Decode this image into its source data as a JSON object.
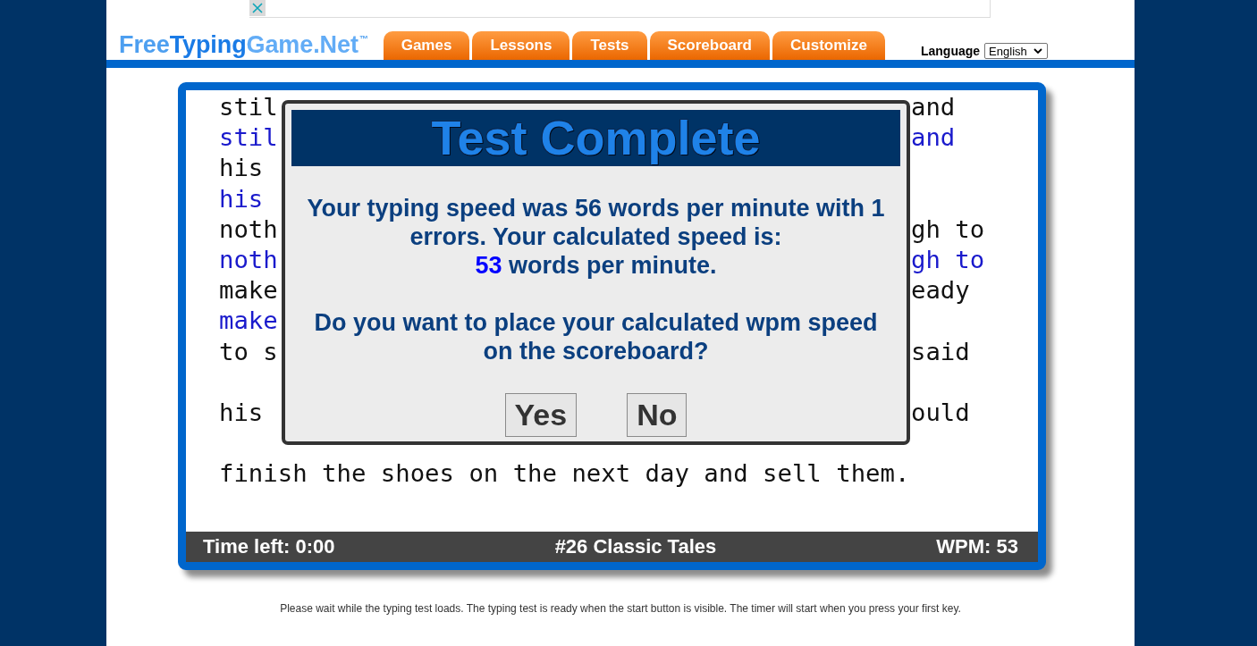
{
  "header": {
    "logo": {
      "parts": [
        "Free",
        "Typing",
        "Game.Net"
      ],
      "trademark": "™"
    },
    "nav_tabs": [
      {
        "label": "Games",
        "selected": false
      },
      {
        "label": "Lessons",
        "selected": false
      },
      {
        "label": "Tests",
        "selected": false
      },
      {
        "label": "Scoreboard",
        "selected": false
      },
      {
        "label": "Customize",
        "selected": false
      }
    ],
    "language": {
      "label": "Language",
      "value": "English"
    }
  },
  "test": {
    "lines": [
      {
        "kind": "source",
        "left": "stil",
        "right": "and"
      },
      {
        "kind": "typed",
        "left": "stil",
        "right": "and"
      },
      {
        "kind": "source",
        "left": "his"
      },
      {
        "kind": "typed",
        "left": "his"
      },
      {
        "kind": "source",
        "left": "noth",
        "right": "gh to"
      },
      {
        "kind": "typed",
        "left": "noth",
        "right": "gh to"
      },
      {
        "kind": "source",
        "left": "make",
        "right": "eady"
      },
      {
        "kind": "typed",
        "left": "make"
      },
      {
        "kind": "source",
        "left": "to s",
        "right": "said"
      },
      {
        "kind": "blank"
      },
      {
        "kind": "source",
        "left": "his",
        "right": "ould"
      },
      {
        "kind": "blank"
      },
      {
        "kind": "source",
        "left": "finish the shoes on the next day and sell them."
      }
    ],
    "status_bar": {
      "time_left": "Time left: 0:00",
      "test_name": "#26 Classic Tales",
      "wpm": "WPM: 53"
    }
  },
  "dialog": {
    "title": "Test Complete",
    "result": {
      "text": "Your typing speed was 56 words per minute with 1 errors. Your calculated speed is:",
      "calculated_wpm": "53",
      "unit": "words per minute."
    },
    "question": "Do you want to place your calculated wpm speed on the scoreboard?",
    "buttons": [
      "Yes",
      "No"
    ]
  },
  "footer_note": "Please wait while the typing test loads. The typing test is ready when the start button is visible. The timer will start when you press your first key."
}
